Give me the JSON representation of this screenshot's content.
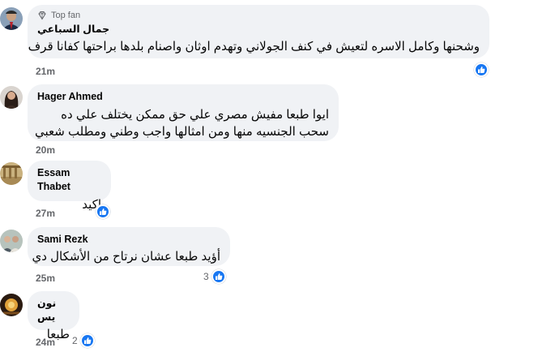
{
  "colors": {
    "bubble": "#f0f2f5",
    "meta_text": "#65676b",
    "like_blue": "#1877f2"
  },
  "comments": [
    {
      "badge": "Top fan",
      "badge_icon": "diamond-icon",
      "author": "جمال السباعي",
      "lines": [
        "وشحنها وكامل الاسره لتعيش في كنف الجولاني وتهدم اوثان واصنام بلدها براحتها كفانا قرف"
      ],
      "time": "21m",
      "reaction_icon": "like-icon",
      "reaction_count": ""
    },
    {
      "author": "Hager Ahmed",
      "lines": [
        "ايوا طبعا مفيش مصري علي حق ممكن يختلف علي ده",
        "سحب الجنسيه منها ومن امثالها واجب وطني ومطلب شعبي"
      ],
      "time": "20m"
    },
    {
      "author": "Essam Thabet",
      "lines": [
        "اكيد"
      ],
      "time": "27m",
      "reaction_icon": "like-icon",
      "reaction_count": ""
    },
    {
      "author": "Sami Rezk",
      "lines": [
        "أؤيد طبعا عشان نرتاح من الأشكال دي"
      ],
      "time": "25m",
      "reaction_icon": "like-icon",
      "reaction_count": "3"
    },
    {
      "author": "نون يس",
      "lines": [
        "طبعا"
      ],
      "time": "24m",
      "reaction_icon": "like-icon",
      "reaction_count": "2"
    }
  ]
}
